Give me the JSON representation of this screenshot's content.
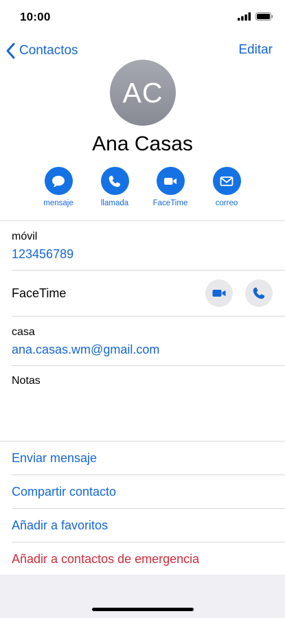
{
  "status": {
    "time": "10:00"
  },
  "nav": {
    "back_label": "Contactos",
    "edit_label": "Editar"
  },
  "contact": {
    "initials": "AC",
    "name": "Ana Casas"
  },
  "actions": [
    {
      "label": "mensaje",
      "icon": "message-bubble-icon"
    },
    {
      "label": "llamada",
      "icon": "phone-icon"
    },
    {
      "label": "FaceTime",
      "icon": "video-camera-icon"
    },
    {
      "label": "correo",
      "icon": "envelope-icon"
    }
  ],
  "fields": {
    "mobile": {
      "label": "móvil",
      "value": "123456789"
    },
    "facetime": {
      "label": "FaceTime"
    },
    "email": {
      "label": "casa",
      "value": "ana.casas.wm@gmail.com"
    },
    "notes": {
      "label": "Notas"
    }
  },
  "links": {
    "send_message": "Enviar mensaje",
    "share_contact": "Compartir contacto",
    "add_favorites": "Añadir a favoritos",
    "add_emergency": "Añadir a contactos de emergencia"
  },
  "colors": {
    "accent": "#1566d6",
    "action_fill": "#1572e4",
    "danger": "#d12b3a",
    "avatar": "#9a9ca5"
  }
}
